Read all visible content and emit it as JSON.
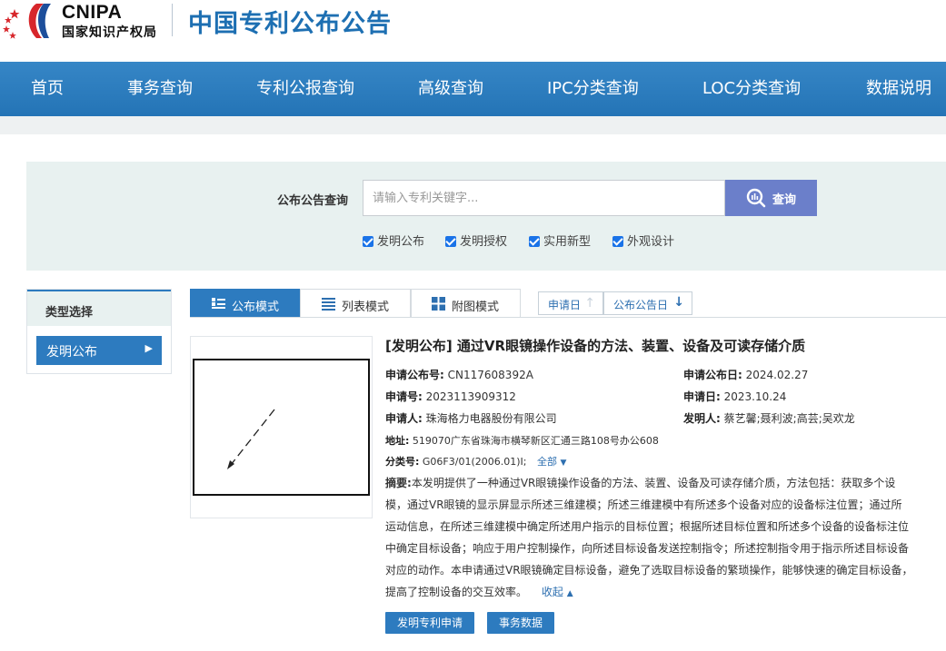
{
  "header": {
    "logo_en": "CNIPA",
    "logo_cn": "国家知识产权局",
    "site_title": "中国专利公布公告"
  },
  "nav": {
    "items": [
      "首页",
      "事务查询",
      "专利公报查询",
      "高级查询",
      "IPC分类查询",
      "LOC分类查询",
      "数据说明"
    ]
  },
  "search": {
    "label": "公布公告查询",
    "placeholder": "请输入专利关键字...",
    "value": "",
    "button": "查询",
    "filters": [
      {
        "label": "发明公布",
        "checked": true
      },
      {
        "label": "发明授权",
        "checked": true
      },
      {
        "label": "实用新型",
        "checked": true
      },
      {
        "label": "外观设计",
        "checked": true
      }
    ]
  },
  "sidebar": {
    "heading": "类型选择",
    "items": [
      {
        "label": "发明公布",
        "selected": true
      }
    ]
  },
  "view_tabs": [
    {
      "label": "公布模式",
      "active": true,
      "icon": "list-bullets-icon"
    },
    {
      "label": "列表模式",
      "active": false,
      "icon": "list-icon"
    },
    {
      "label": "附图模式",
      "active": false,
      "icon": "grid-icon"
    }
  ],
  "sort": [
    {
      "label": "申请日",
      "arrow": "↑",
      "active": false
    },
    {
      "label": "公布公告日",
      "arrow": "↓",
      "active": true
    }
  ],
  "result": {
    "title": "[发明公布] 通过VR眼镜操作设备的方法、装置、设备及可读存储介质",
    "pub_no_label": "申请公布号:",
    "pub_no": "CN117608392A",
    "pub_date_label": "申请公布日:",
    "pub_date": "2024.02.27",
    "app_no_label": "申请号:",
    "app_no": "2023113909312",
    "app_date_label": "申请日:",
    "app_date": "2023.10.24",
    "applicant_label": "申请人:",
    "applicant": "珠海格力电器股份有限公司",
    "inventor_label": "发明人:",
    "inventor": "蔡艺馨;聂利波;高芸;吴欢龙",
    "address_label": "地址:",
    "address": "519070广东省珠海市横琴新区汇通三路108号办公608",
    "class_label": "分类号:",
    "class": "G06F3/01(2006.01)I;",
    "class_all": "全部",
    "abstract_label": "摘要:",
    "abstract_lines": [
      "本发明提供了一种通过VR眼镜操作设备的方法、装置、设备及可读存储介质，方法包括：获取多个设",
      "模，通过VR眼镜的显示屏显示所述三维建模；所述三维建模中有所述多个设备对应的设备标注位置；通过所",
      "运动信息，在所述三维建模中确定所述用户指示的目标位置；根据所述目标位置和所述多个设备的设备标注位",
      "中确定目标设备；响应于用户控制操作，向所述目标设备发送控制指令；所述控制指令用于指示所述目标设备",
      "对应的动作。本申请通过VR眼镜确定目标设备，避免了选取目标设备的繁琐操作，能够快速的确定目标设备，",
      "提高了控制设备的交互效率。"
    ],
    "collapse": "收起",
    "buttons": [
      "发明专利申请",
      "事务数据"
    ]
  }
}
